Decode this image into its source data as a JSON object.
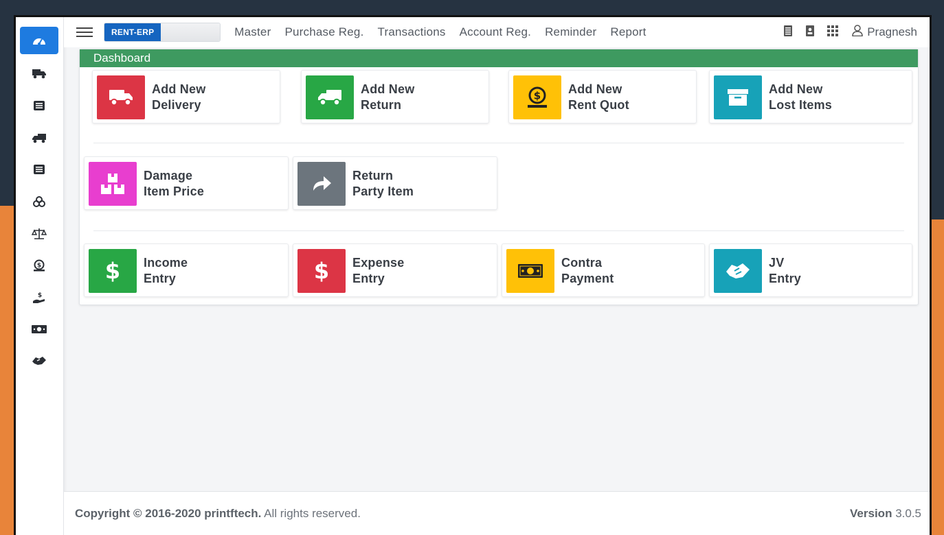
{
  "brand": {
    "name": "RENT-ERP"
  },
  "nav": [
    "Master",
    "Purchase Reg.",
    "Transactions",
    "Account Reg.",
    "Reminder",
    "Report"
  ],
  "user": {
    "name": "Pragnesh"
  },
  "panel": {
    "title": "Dashboard"
  },
  "cards": {
    "delivery": {
      "line1": "Add New",
      "line2": "Delivery",
      "color": "#dc3545"
    },
    "return": {
      "line1": "Add New",
      "line2": "Return",
      "color": "#28a745"
    },
    "rent_quot": {
      "line1": "Add New",
      "line2": "Rent Quot",
      "color": "#ffc107"
    },
    "lost_items": {
      "line1": "Add New",
      "line2": "Lost Items",
      "color": "#17a2b8"
    },
    "damage": {
      "line1": "Damage",
      "line2": "Item Price",
      "color": "#e83ecf"
    },
    "return_party": {
      "line1": "Return",
      "line2": "Party Item",
      "color": "#6c757d"
    },
    "income": {
      "line1": "Income",
      "line2": "Entry",
      "color": "#28a745"
    },
    "expense": {
      "line1": "Expense",
      "line2": "Entry",
      "color": "#dc3545"
    },
    "contra": {
      "line1": "Contra",
      "line2": "Payment",
      "color": "#ffc107"
    },
    "jv": {
      "line1": "JV",
      "line2": "Entry",
      "color": "#17a2b8"
    }
  },
  "footer": {
    "copyright_bold": "Copyright © 2016-2020 printftech.",
    "copyright_rest": " All rights reserved.",
    "version_label": "Version",
    "version_number": "3.0.5"
  }
}
